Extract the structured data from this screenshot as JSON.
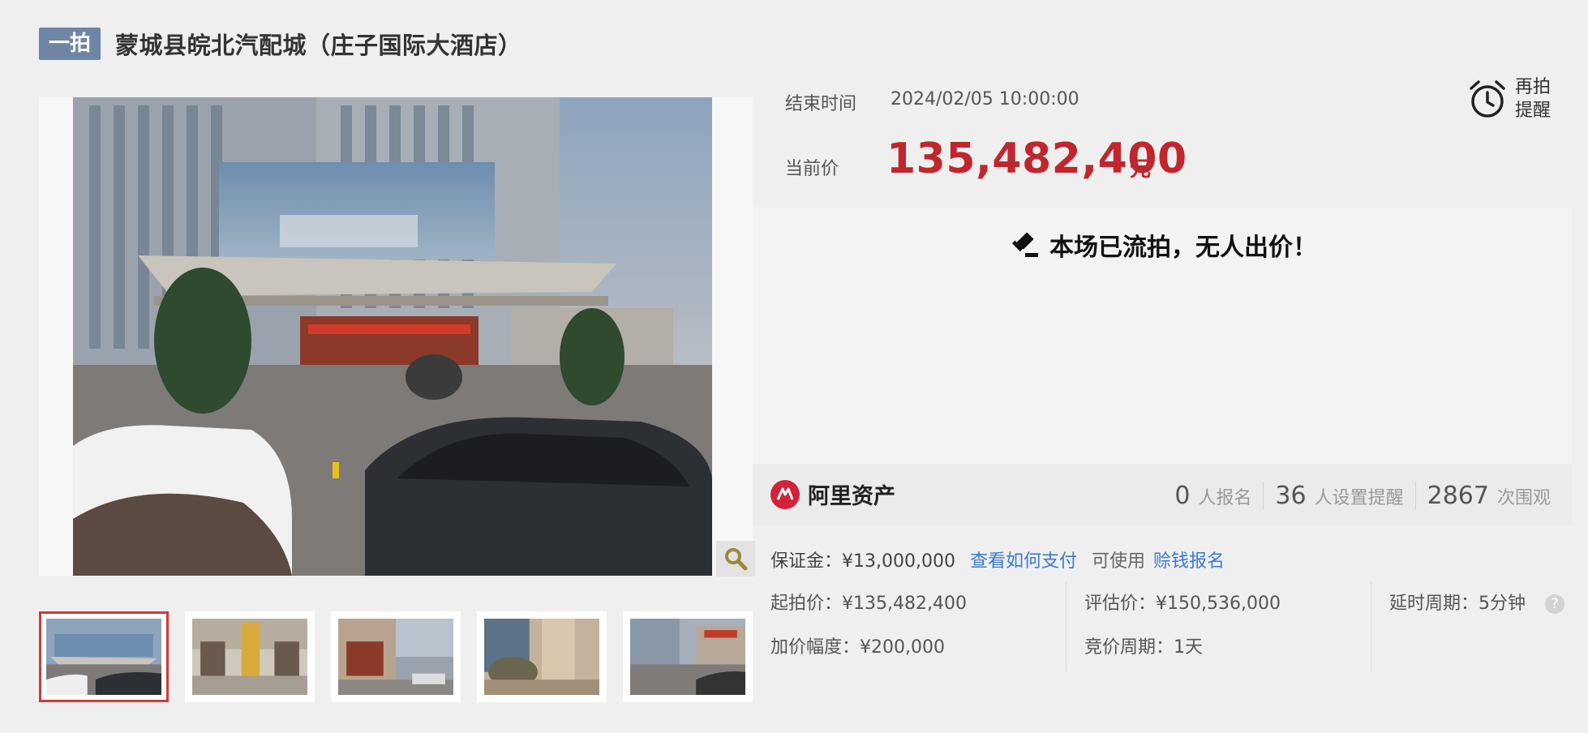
{
  "header": {
    "round_badge": "一拍",
    "title": "蒙城县皖北汽配城（庄子国际大酒店）"
  },
  "auction": {
    "end_time_label": "结束时间",
    "end_time_value": "2024/02/05 10:00:00",
    "price_label": "当前价",
    "price_value": "135,482,400",
    "price_unit": "元",
    "remind_label": "再拍提醒"
  },
  "status": {
    "message": "本场已流拍，无人出价！"
  },
  "platform": {
    "name": "阿里资产"
  },
  "stats": [
    {
      "num": "0",
      "label": "人报名"
    },
    {
      "num": "36",
      "label": "人设置提醒"
    },
    {
      "num": "2867",
      "label": "次围观"
    }
  ],
  "details": {
    "deposit": "保证金：¥13,000,000",
    "pay_link": "查看如何支付",
    "can_use": "可使用",
    "earn_link": "赊钱报名",
    "start_price": "起拍价：¥135,482,400",
    "increment": "加价幅度：¥200,000",
    "appraisal": "评估价：¥150,536,000",
    "bid_period": "竞价周期：1天",
    "delay_period": "延时周期：5分钟",
    "help": "?"
  },
  "gallery": {
    "thumbnail_count": 5,
    "active_index": 0
  },
  "colors": {
    "price": "#c0262d",
    "badge": "#6f85a6",
    "link": "#3a7bd5",
    "active_border": "#d03a35"
  }
}
